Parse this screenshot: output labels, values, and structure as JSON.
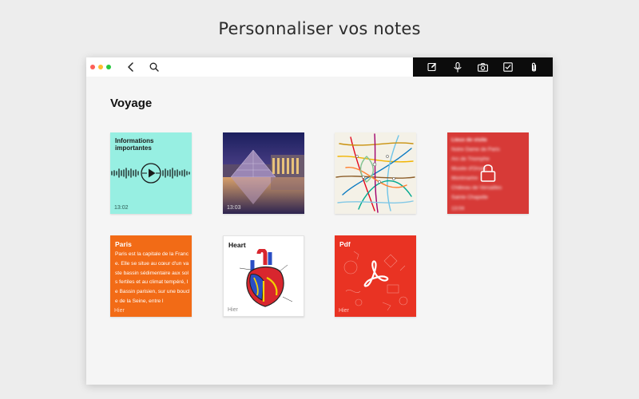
{
  "headline": "Personnaliser vos notes",
  "window": {
    "toolbar": {
      "left_icons": [
        "chevron-left-icon",
        "search-icon"
      ],
      "right_icons": [
        "compose-icon",
        "microphone-icon",
        "camera-icon",
        "checkbox-icon",
        "paperclip-icon"
      ]
    },
    "section_title": "Voyage",
    "notes": [
      {
        "title": "Informations importantes",
        "time": "13:02"
      },
      {
        "time": "13:03"
      },
      {},
      {
        "locked": true,
        "title": "Lieux de visite",
        "lines": [
          "Notre Dame de Paris",
          "Arc de Triomphe",
          "Musée d'Orsay",
          "Montmartre",
          "Château de Versailles",
          "Sainte Chapelle"
        ],
        "time": "13:04"
      },
      {
        "title": "Paris",
        "body": "Paris est la capitale de la France. Elle se situe au cœur d'un vaste bassin sédimentaire aux sols fertiles et au climat tempéré, le Bassin parisien, sur une boucle de la Seine, entre l",
        "time": "Hier"
      },
      {
        "title": "Heart",
        "time": "Hier"
      },
      {
        "title": "Pdf",
        "time": "Hier"
      }
    ]
  },
  "colors": {
    "audio_note": "#97efe2",
    "text_note": "#f26b16",
    "pdf_note": "#e93323",
    "locked_note": "#d73a37",
    "toolbar_dark": "#0c0c0c"
  }
}
